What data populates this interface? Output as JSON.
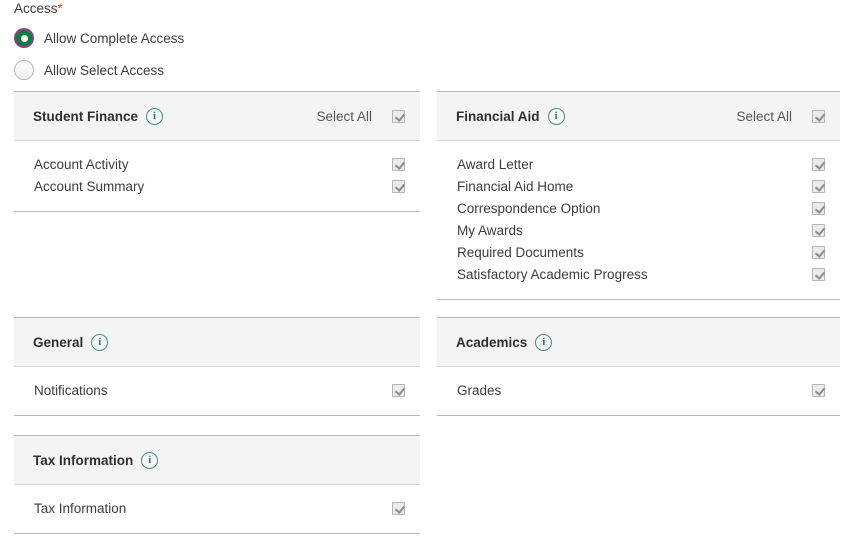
{
  "form": {
    "access_label": "Access",
    "required_marker": "*",
    "radios": [
      {
        "label": "Allow Complete Access",
        "selected": true
      },
      {
        "label": "Allow Select Access",
        "selected": false
      }
    ]
  },
  "labels": {
    "select_all": "Select All",
    "info_icon_glyph": "i"
  },
  "colors": {
    "radio_selected_ring": "#0a7d3f",
    "radio_focus_ring": "#8e3f8e",
    "info_icon": "#2f7d6d",
    "required_star": "#c05621",
    "panel_header_bg": "#f4f4f4",
    "text": "#3c3c41"
  },
  "panels": [
    {
      "title": "Student Finance",
      "has_select_all": true,
      "select_all_checked": true,
      "items": [
        {
          "label": "Account Activity",
          "checked": true
        },
        {
          "label": "Account Summary",
          "checked": true
        }
      ]
    },
    {
      "title": "Financial Aid",
      "has_select_all": true,
      "select_all_checked": true,
      "items": [
        {
          "label": "Award Letter",
          "checked": true
        },
        {
          "label": "Financial Aid Home",
          "checked": true
        },
        {
          "label": "Correspondence Option",
          "checked": true
        },
        {
          "label": "My Awards",
          "checked": true
        },
        {
          "label": "Required Documents",
          "checked": true
        },
        {
          "label": "Satisfactory Academic Progress",
          "checked": true
        }
      ]
    },
    {
      "title": "General",
      "has_select_all": false,
      "select_all_checked": false,
      "items": [
        {
          "label": "Notifications",
          "checked": true
        }
      ]
    },
    {
      "title": "Academics",
      "has_select_all": false,
      "select_all_checked": false,
      "items": [
        {
          "label": "Grades",
          "checked": true
        }
      ]
    },
    {
      "title": "Tax Information",
      "has_select_all": false,
      "select_all_checked": false,
      "items": [
        {
          "label": "Tax Information",
          "checked": true
        }
      ]
    }
  ]
}
